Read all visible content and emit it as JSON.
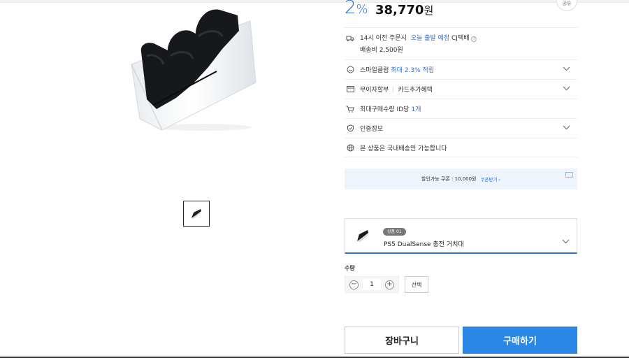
{
  "price": {
    "discount_number": "2",
    "discount_unit": "%",
    "amount": "38,770",
    "currency": "원"
  },
  "share_label": "공유",
  "info": {
    "delivery_line1_prefix": "14시 이전 주문시",
    "delivery_line1_blue": "오늘 출발 예정",
    "delivery_line1_suffix": "CJ택배",
    "delivery_line2": "배송비 2,500원",
    "smile_prefix": "스마일클럽",
    "smile_blue": "최대 2.3% 적립",
    "installment_label": "무이자할부",
    "card_benefit_label": "카드추가혜택",
    "limit_prefix": "최대구매수량 ID당",
    "limit_blue": "1개",
    "cert_label": "인증정보",
    "domestic_label": "본 상품은 국내배송만 가능합니다"
  },
  "coupon": {
    "text": "할인가능 쿠폰 : 10,000원",
    "more": "쿠폰받기 ›"
  },
  "option": {
    "badge": "상품 01",
    "name": "PS5 DualSense 충전 거치대"
  },
  "quantity": {
    "label": "수량",
    "value": "1",
    "minus": "−",
    "plus": "+",
    "select_label": "선택"
  },
  "actions": {
    "cart": "장바구니",
    "buy": "구매하기"
  },
  "colors": {
    "accent": "#2b6fd6",
    "buy_button": "#2a87e6",
    "coupon_bg": "#eef4fc"
  }
}
